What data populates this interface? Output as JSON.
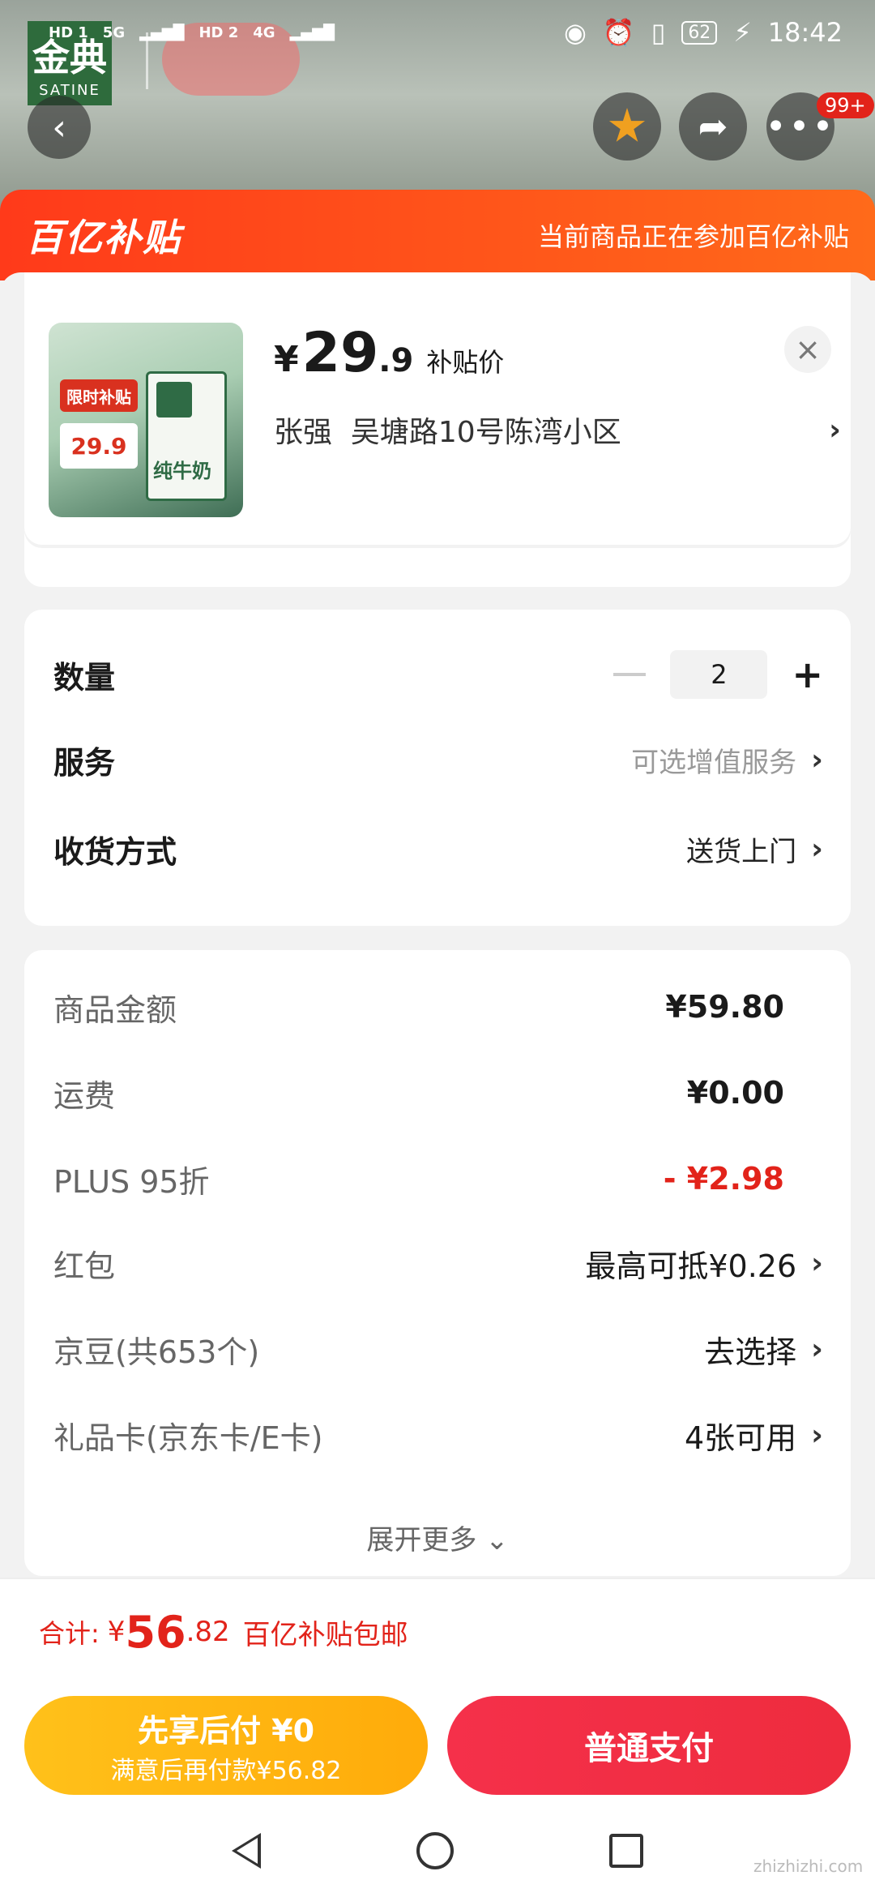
{
  "status_bar": {
    "left_labels": [
      "HD 1",
      "5G",
      "HD 2",
      "4G"
    ],
    "battery": "62",
    "time": "18:42"
  },
  "background": {
    "brand_logo": "金典",
    "brand_sub": "SATINE"
  },
  "top_actions": {
    "more_badge": "99+"
  },
  "banner": {
    "logo": "百亿补贴",
    "text": "当前商品正在参加百亿补贴"
  },
  "product": {
    "price_symbol": "¥",
    "price_int": "29",
    "price_dec": ".9",
    "price_tag": "补贴价",
    "image_tag": "限时补贴",
    "image_price": "29.9",
    "image_milk": "纯牛奶",
    "recipient": "张强",
    "address": "吴塘路10号陈湾小区"
  },
  "options": {
    "quantity_label": "数量",
    "quantity_value": "2",
    "service_label": "服务",
    "service_value": "可选增值服务",
    "delivery_label": "收货方式",
    "delivery_value": "送货上门"
  },
  "details": {
    "rows": [
      {
        "label": "商品金额",
        "value": "¥59.80"
      },
      {
        "label": "运费",
        "value": "¥0.00"
      },
      {
        "label": "PLUS 95折",
        "value": "- ¥2.98"
      },
      {
        "label": "红包",
        "value": "最高可抵¥0.26"
      },
      {
        "label": "京豆(共653个)",
        "value": "去选择"
      },
      {
        "label": "礼品卡(京东卡/E卡)",
        "value": "4张可用"
      }
    ],
    "expand_label": "展开更多"
  },
  "total": {
    "label": "合计:",
    "symbol": "¥",
    "int": "56",
    "dec": ".82",
    "note": "百亿补贴包邮"
  },
  "buttons": {
    "paylater_line1": "先享后付 ¥0",
    "paylater_line2": "满意后再付款¥56.82",
    "pay_label": "普通支付"
  },
  "watermark": "zhizhizhi.com",
  "colors": {
    "accent_red": "#e2231a",
    "banner_orange": "#ff4a1a",
    "paylater_yellow": "#ffb813",
    "pay_red": "#f0303f"
  }
}
